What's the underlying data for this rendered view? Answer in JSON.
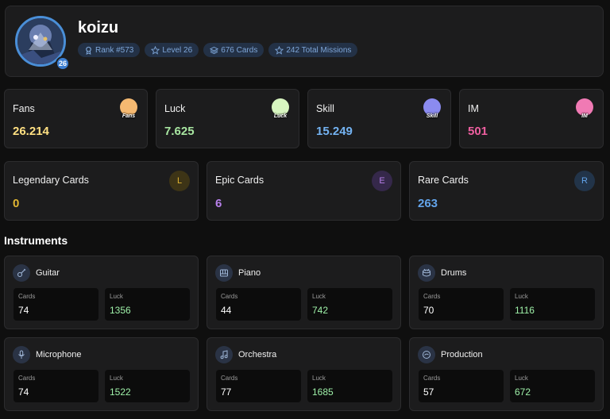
{
  "profile": {
    "username": "koizu",
    "level_badge": "26",
    "badges": [
      {
        "icon": "award-icon",
        "text": "Rank #573"
      },
      {
        "icon": "star-icon",
        "text": "Level 26"
      },
      {
        "icon": "layers-icon",
        "text": "676 Cards"
      },
      {
        "icon": "star-icon",
        "text": "242 Total Missions"
      }
    ]
  },
  "stats": [
    {
      "label": "Fans",
      "value": "26.214",
      "color": "#ffe082",
      "icon": "fans-icon",
      "icon_text": "Fans",
      "icon_color": "#f5b971"
    },
    {
      "label": "Luck",
      "value": "7.625",
      "color": "#a8e6a1",
      "icon": "luck-clover-icon",
      "icon_text": "Luck",
      "icon_color": "#d7f5c0"
    },
    {
      "label": "Skill",
      "value": "15.249",
      "color": "#74b3f2",
      "icon": "skill-icon",
      "icon_text": "Skill",
      "icon_color": "#8b8bf0"
    },
    {
      "label": "IM",
      "value": "501",
      "color": "#ee5fa0",
      "icon": "im-icon",
      "icon_text": "IM",
      "icon_color": "#f07ab4"
    }
  ],
  "rarities": [
    {
      "label": "Legendary Cards",
      "value": "0",
      "letter": "L",
      "color": "#e0b532",
      "badge_bg": "#3d3416"
    },
    {
      "label": "Epic Cards",
      "value": "6",
      "letter": "E",
      "color": "#b780ea",
      "badge_bg": "#35284a"
    },
    {
      "label": "Rare Cards",
      "value": "263",
      "letter": "R",
      "color": "#63a4ea",
      "badge_bg": "#223449"
    }
  ],
  "instruments_title": "Instruments",
  "instruments": [
    {
      "name": "Guitar",
      "icon": "guitar-icon",
      "cards_label": "Cards",
      "cards": "74",
      "luck_label": "Luck",
      "luck": "1356"
    },
    {
      "name": "Piano",
      "icon": "piano-icon",
      "cards_label": "Cards",
      "cards": "44",
      "luck_label": "Luck",
      "luck": "742"
    },
    {
      "name": "Drums",
      "icon": "drum-icon",
      "cards_label": "Cards",
      "cards": "70",
      "luck_label": "Luck",
      "luck": "1116"
    },
    {
      "name": "Microphone",
      "icon": "microphone-icon",
      "cards_label": "Cards",
      "cards": "74",
      "luck_label": "Luck",
      "luck": "1522"
    },
    {
      "name": "Orchestra",
      "icon": "music-note-icon",
      "cards_label": "Cards",
      "cards": "77",
      "luck_label": "Luck",
      "luck": "1685"
    },
    {
      "name": "Production",
      "icon": "production-disc-icon",
      "cards_label": "Cards",
      "cards": "57",
      "luck_label": "Luck",
      "luck": "672"
    }
  ],
  "theme": {
    "luck_value_color": "#9ef0a8",
    "icon_color": "#9fb6d6"
  }
}
